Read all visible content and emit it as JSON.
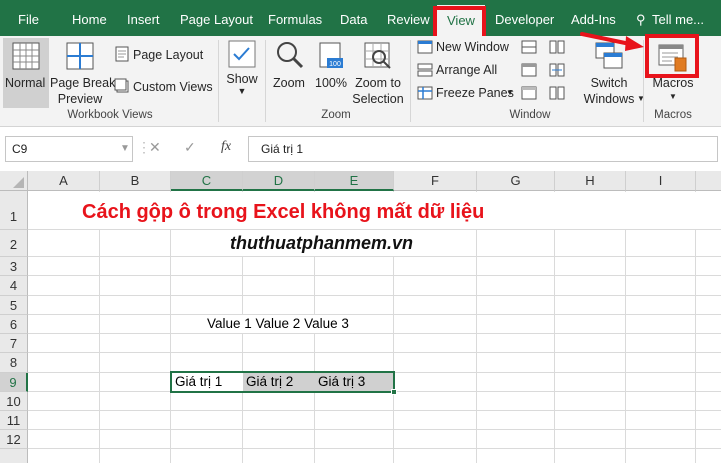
{
  "tabs": [
    {
      "label": "File",
      "active": false
    },
    {
      "label": "Home",
      "active": false
    },
    {
      "label": "Insert",
      "active": false
    },
    {
      "label": "Page Layout",
      "active": false
    },
    {
      "label": "Formulas",
      "active": false
    },
    {
      "label": "Data",
      "active": false
    },
    {
      "label": "Review",
      "active": false
    },
    {
      "label": "View",
      "active": true
    },
    {
      "label": "Developer",
      "active": false
    },
    {
      "label": "Add-Ins",
      "active": false
    }
  ],
  "tell_me": "Tell me...",
  "ribbon": {
    "workbook_views": {
      "normal": "Normal",
      "page_break_line1": "Page Break",
      "page_break_line2": "Preview",
      "page_layout": "Page Layout",
      "custom_views": "Custom Views",
      "group_label": "Workbook Views"
    },
    "show": {
      "label": "Show"
    },
    "zoom": {
      "zoom": "Zoom",
      "zoom100": "100%",
      "zoom_sel_line1": "Zoom to",
      "zoom_sel_line2": "Selection",
      "group_label": "Zoom"
    },
    "window": {
      "new_window": "New Window",
      "arrange_all": "Arrange All",
      "freeze_panes": "Freeze Panes",
      "switch_line1": "Switch",
      "switch_line2": "Windows",
      "group_label": "Window"
    },
    "macros": {
      "label": "Macros",
      "group_label": "Macros"
    }
  },
  "formula_bar": {
    "name_box": "C9",
    "cancel": "✕",
    "enter": "✓",
    "fx": "fx",
    "content": "Giá trị 1"
  },
  "sheet": {
    "columns": [
      "A",
      "B",
      "C",
      "D",
      "E",
      "F",
      "G",
      "H",
      "I"
    ],
    "rows": [
      "1",
      "2",
      "3",
      "4",
      "5",
      "6",
      "7",
      "8",
      "9",
      "10",
      "11",
      "12"
    ],
    "title": "Cách gộp ô trong Excel không mất dữ liệu",
    "website": "thuthuatphanmem.vn",
    "row6_text": "Value 1 Value 2 Value 3",
    "c9": "Giá trị 1",
    "d9": "Giá trị 2",
    "e9": "Giá trị 3"
  },
  "colors": {
    "ribbon_green": "#217346",
    "highlight_red": "#e8131b",
    "title_red": "#e8131b"
  }
}
